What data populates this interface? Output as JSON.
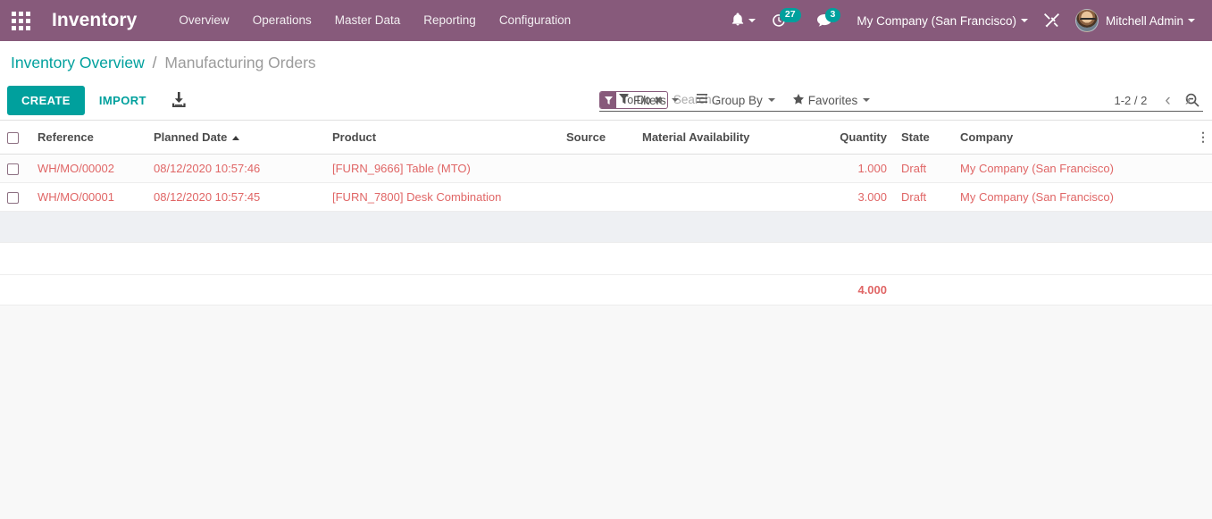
{
  "navbar": {
    "apps_icon": "apps-grid-icon",
    "brand": "Inventory",
    "menu": [
      {
        "label": "Overview"
      },
      {
        "label": "Operations"
      },
      {
        "label": "Master Data"
      },
      {
        "label": "Reporting"
      },
      {
        "label": "Configuration"
      }
    ],
    "activities_count": "27",
    "messages_count": "3",
    "company": "My Company (San Francisco)",
    "user": "Mitchell Admin"
  },
  "breadcrumb": {
    "parent": "Inventory Overview",
    "separator": "/",
    "current": "Manufacturing Orders"
  },
  "search": {
    "facet_label": "To Do",
    "facet_remove": "✖",
    "placeholder": "Search..."
  },
  "toolbar": {
    "create_label": "CREATE",
    "import_label": "IMPORT",
    "upload_icon": "download-icon",
    "filters_label": "Filters",
    "groupby_label": "Group By",
    "favorites_label": "Favorites",
    "pager_text": "1-2 / 2",
    "pager_prev": "‹",
    "pager_next": "›"
  },
  "list": {
    "columns": [
      {
        "label": "Reference",
        "align": "left"
      },
      {
        "label": "Planned Date",
        "align": "left",
        "sorted": "asc"
      },
      {
        "label": "Product",
        "align": "left"
      },
      {
        "label": "Source",
        "align": "left"
      },
      {
        "label": "Material Availability",
        "align": "left"
      },
      {
        "label": "Quantity",
        "align": "right"
      },
      {
        "label": "State",
        "align": "left"
      },
      {
        "label": "Company",
        "align": "left"
      }
    ],
    "options_icon": "vertical-dots-icon",
    "rows": [
      {
        "reference": "WH/MO/00002",
        "planned_date": "08/12/2020 10:57:46",
        "product": "[FURN_9666] Table (MTO)",
        "source": "",
        "material_availability": "",
        "quantity": "1.000",
        "state": "Draft",
        "company": "My Company (San Francisco)"
      },
      {
        "reference": "WH/MO/00001",
        "planned_date": "08/12/2020 10:57:45",
        "product": "[FURN_7800] Desk Combination",
        "source": "",
        "material_availability": "",
        "quantity": "3.000",
        "state": "Draft",
        "company": "My Company (San Francisco)"
      }
    ],
    "total_quantity": "4.000"
  },
  "colors": {
    "brand_purple": "#875a7b",
    "accent_teal": "#00A09D",
    "row_text_red": "#cf4f4f"
  }
}
